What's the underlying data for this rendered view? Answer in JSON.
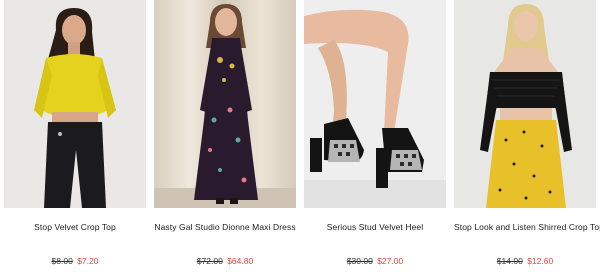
{
  "colors": {
    "sale_price": "#e4463c",
    "text": "#222222",
    "background": "#ffffff"
  },
  "products": [
    {
      "name": "Stop Velvet Crop Top",
      "old_price": "$8.00",
      "sale_price": "$7.20",
      "image": "model-yellow-velvet-crop-top"
    },
    {
      "name": "Nasty Gal Studio Dionne Maxi Dress",
      "old_price": "$72.00",
      "sale_price": "$64.80",
      "image": "model-black-floral-maxi-dress"
    },
    {
      "name": "Serious Stud Velvet Heel",
      "old_price": "$30.00",
      "sale_price": "$27.00",
      "image": "black-platform-heels-on-legs"
    },
    {
      "name": "Stop Look and Listen Shirred Crop Top",
      "old_price": "$14.00",
      "sale_price": "$12.60",
      "image": "model-black-shirred-crop-top-yellow-skirt"
    }
  ]
}
